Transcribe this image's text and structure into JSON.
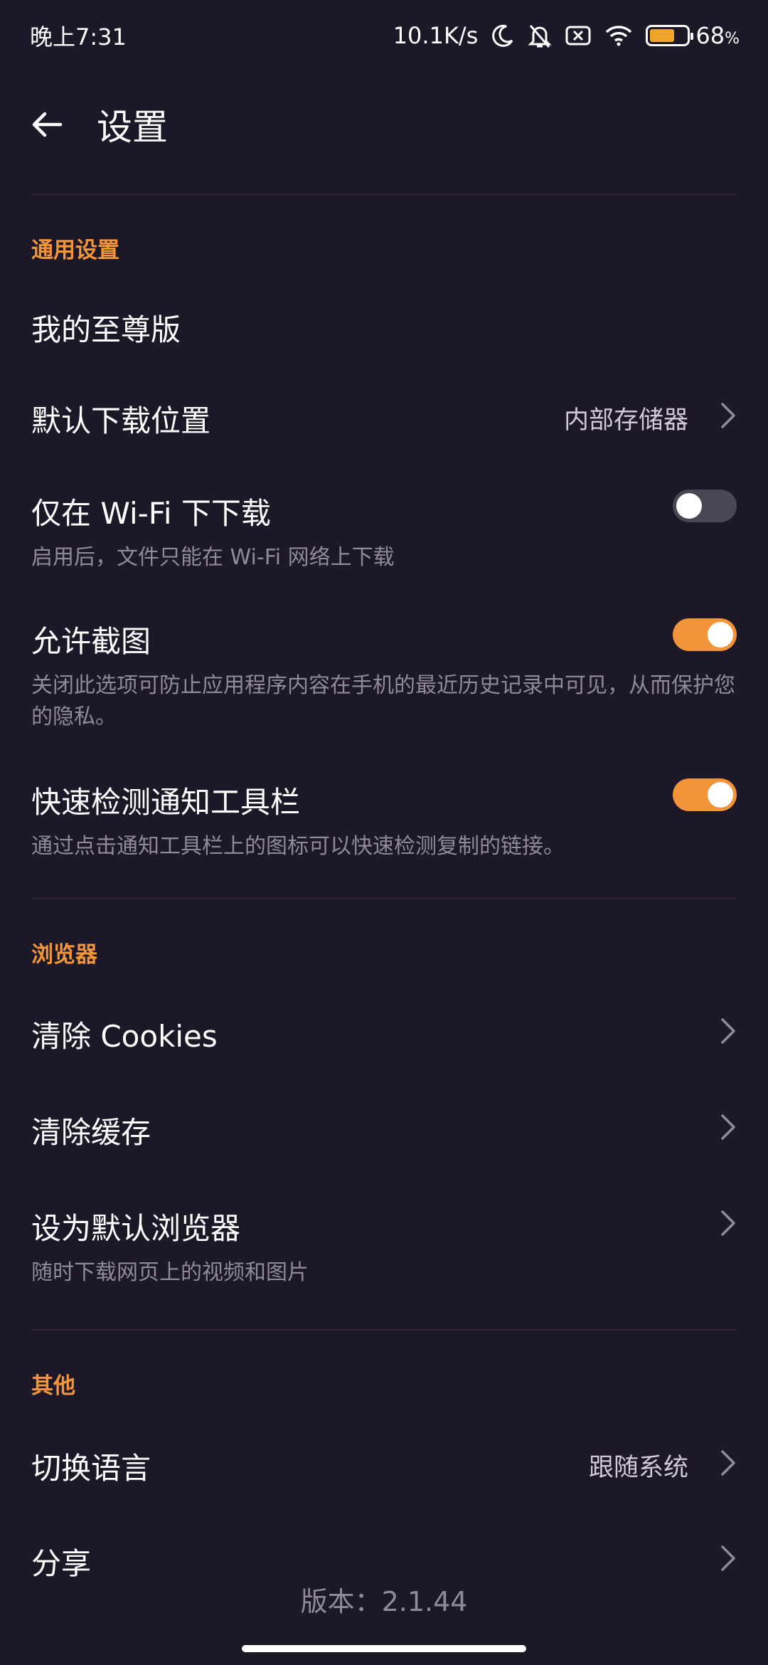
{
  "status_bar": {
    "time": "晚上7:31",
    "net_speed": "10.1K/s",
    "battery_percent": "68",
    "battery_unit": "%",
    "battery_level": 0.68,
    "battery_color": "#f0a52a",
    "icons": [
      "moon-icon",
      "bell-off-icon",
      "sim-off-icon",
      "wifi-icon",
      "battery-icon"
    ]
  },
  "header": {
    "title": "设置",
    "back_icon": "arrow-left-icon"
  },
  "colors": {
    "background": "#1d1827",
    "accent": "#f2953a",
    "secondary_text": "#8f8a97"
  },
  "general": {
    "label": "通用设置",
    "premium": {
      "title": "我的至尊版"
    },
    "download_location": {
      "title": "默认下载位置",
      "value": "内部存储器"
    },
    "wifi_only": {
      "title": "仅在 Wi-Fi 下下载",
      "desc": "启用后，文件只能在 Wi-Fi 网络上下载",
      "enabled": false
    },
    "screenshots": {
      "title": "允许截图",
      "desc": "关闭此选项可防止应用程序内容在手机的最近历史记录中可见，从而保护您的隐私。",
      "enabled": true
    },
    "quick_detect": {
      "title": "快速检测通知工具栏",
      "desc": "通过点击通知工具栏上的图标可以快速检测复制的链接。",
      "enabled": true
    }
  },
  "browser": {
    "label": "浏览器",
    "clear_cookies": {
      "title": "清除 Cookies"
    },
    "clear_cache": {
      "title": "清除缓存"
    },
    "default_browser": {
      "title": "设为默认浏览器",
      "desc": "随时下载网页上的视频和图片"
    }
  },
  "other": {
    "label": "其他",
    "language": {
      "title": "切换语言",
      "value": "跟随系统"
    },
    "share": {
      "title": "分享"
    }
  },
  "version": "版本：2.1.44"
}
